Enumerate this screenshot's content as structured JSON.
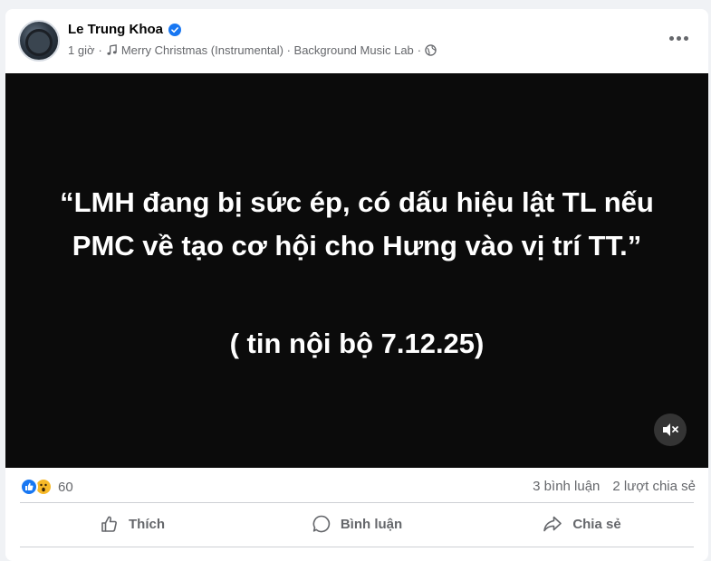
{
  "post": {
    "author": "Le Trung Khoa",
    "time": "1 giờ",
    "music": "Merry Christmas (Instrumental) · Background Music Lab",
    "privacy_icon": "globe-icon"
  },
  "video": {
    "quote": "“LMH đang bị sức ép, có dấu hiệu lật TL nếu PMC về tạo cơ hội cho Hưng vào vị trí TT.”",
    "source": "( tin nội bộ 7.12.25)"
  },
  "stats": {
    "reaction_count": "60",
    "comments": "3 bình luận",
    "shares": "2 lượt chia sẻ"
  },
  "actions": {
    "like": "Thích",
    "comment": "Bình luận",
    "share": "Chia sẻ"
  },
  "colors": {
    "accent": "#1877f2",
    "secondary_text": "#65676b",
    "video_bg": "#0b0b0b"
  }
}
